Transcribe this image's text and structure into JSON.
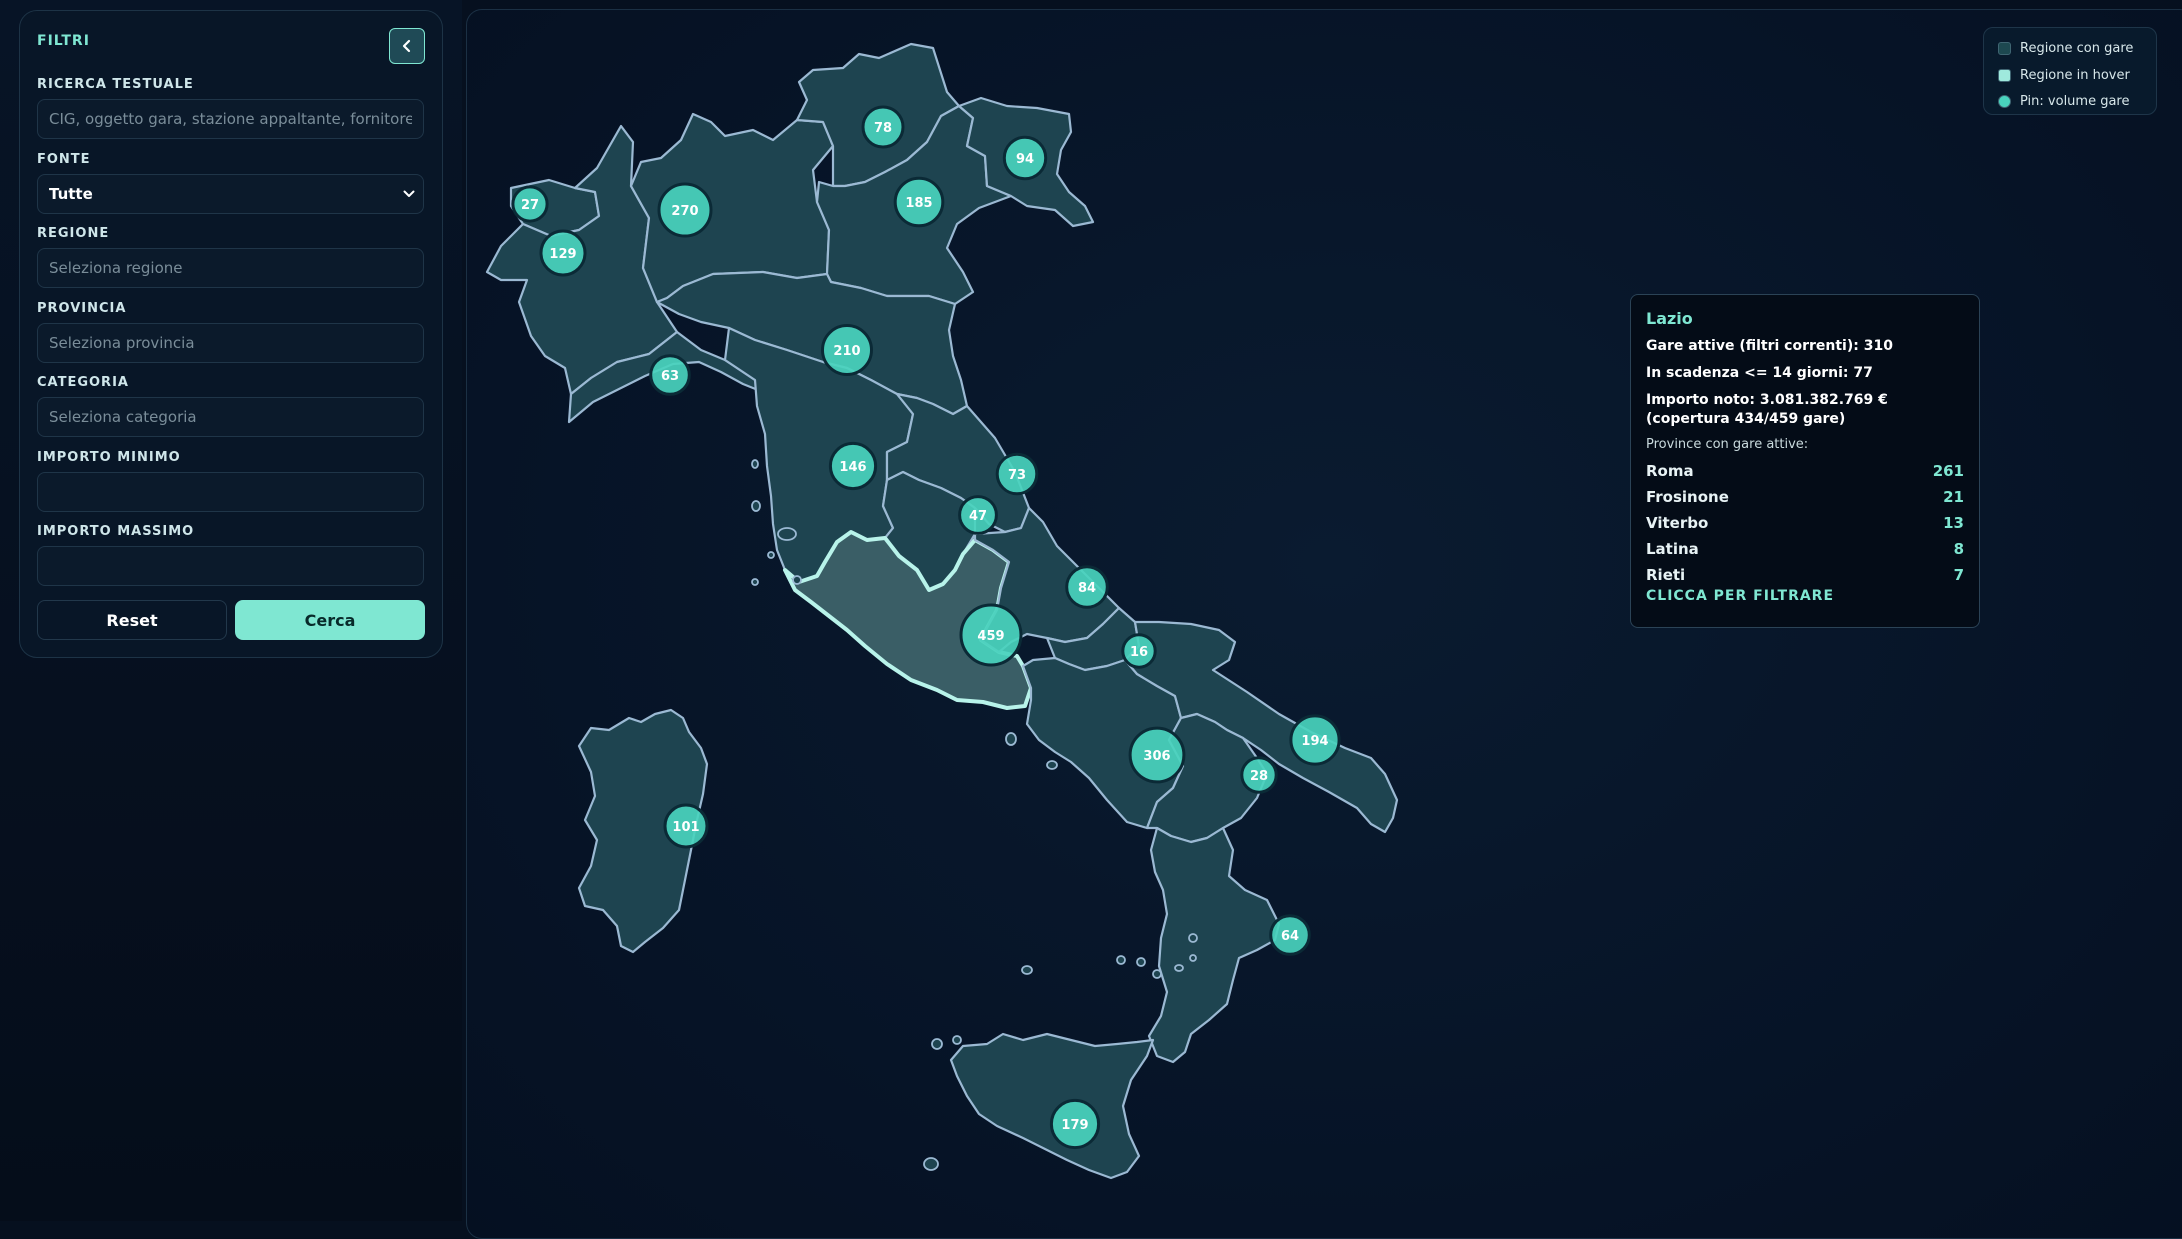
{
  "filters": {
    "title": "FILTRI",
    "search_label": "RICERCA TESTUALE",
    "search_placeholder": "CIG, oggetto gara, stazione appaltante, fornitore...",
    "source_label": "FONTE",
    "source_selected": "Tutte",
    "region_label": "REGIONE",
    "region_placeholder": "Seleziona regione",
    "province_label": "PROVINCIA",
    "province_placeholder": "Seleziona provincia",
    "category_label": "CATEGORIA",
    "category_placeholder": "Seleziona categoria",
    "min_amount_label": "IMPORTO MINIMO",
    "max_amount_label": "IMPORTO MASSIMO",
    "reset_label": "Reset",
    "search_button_label": "Cerca"
  },
  "legend": {
    "items": [
      {
        "label": "Regione con gare",
        "color": "#1d4850"
      },
      {
        "label": "Regione in hover",
        "color": "#9fe9dd"
      },
      {
        "label": "Pin: volume gare",
        "color": "#49d3bd"
      }
    ]
  },
  "colors": {
    "accent": "#7fe7d2",
    "region_fill": "#1e4450",
    "region_stroke": "#9bb9d3",
    "hover_fill": "#3a5e66",
    "hover_stroke": "#b8f3ea",
    "pin_fill": "#49d3bd"
  },
  "pins": [
    {
      "region": "Valle d'Aosta",
      "value": 27
    },
    {
      "region": "Piemonte",
      "value": 129
    },
    {
      "region": "Lombardia",
      "value": 270
    },
    {
      "region": "Trentino-Alto Adige",
      "value": 78
    },
    {
      "region": "Veneto",
      "value": 185
    },
    {
      "region": "Friuli-Venezia Giulia",
      "value": 94
    },
    {
      "region": "Liguria",
      "value": 63
    },
    {
      "region": "Emilia-Romagna",
      "value": 210
    },
    {
      "region": "Toscana",
      "value": 146
    },
    {
      "region": "Umbria",
      "value": 47
    },
    {
      "region": "Marche",
      "value": 73
    },
    {
      "region": "Lazio",
      "value": 459
    },
    {
      "region": "Abruzzo",
      "value": 84
    },
    {
      "region": "Molise",
      "value": 16
    },
    {
      "region": "Campania",
      "value": 306
    },
    {
      "region": "Puglia",
      "value": 194
    },
    {
      "region": "Basilicata",
      "value": 28
    },
    {
      "region": "Calabria",
      "value": 64
    },
    {
      "region": "Sicilia",
      "value": 179
    },
    {
      "region": "Sardegna",
      "value": 101
    }
  ],
  "tooltip": {
    "region": "Lazio",
    "active_label": "Gare attive (filtri correnti):",
    "active_value": "310",
    "expiring_label": "In scadenza <= 14 giorni:",
    "expiring_value": "77",
    "amount_label": "Importo noto:",
    "amount_value": "3.081.382.769 €",
    "coverage": "(copertura 434/459 gare)",
    "provinces_title": "Province con gare attive:",
    "provinces": [
      {
        "name": "Roma",
        "count": "261"
      },
      {
        "name": "Frosinone",
        "count": "21"
      },
      {
        "name": "Viterbo",
        "count": "13"
      },
      {
        "name": "Latina",
        "count": "8"
      },
      {
        "name": "Rieti",
        "count": "7"
      }
    ],
    "cta": "CLICCA PER FILTRARE"
  }
}
